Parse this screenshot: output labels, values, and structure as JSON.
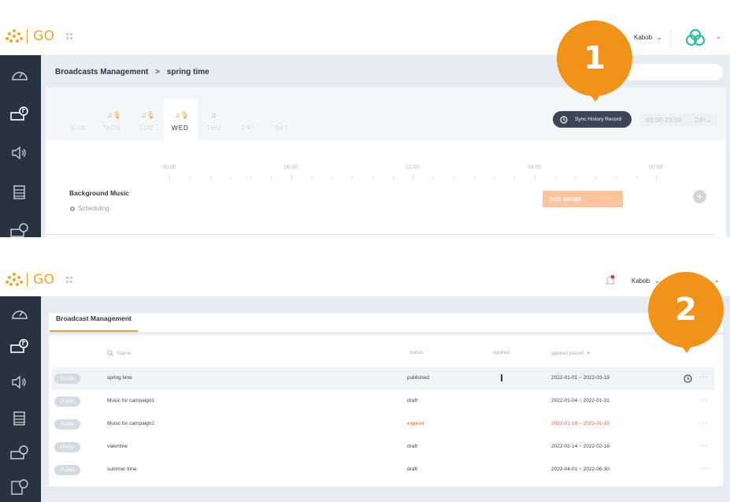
{
  "app": {
    "brand": "GO",
    "user_name": "Kabob"
  },
  "panel1": {
    "breadcrumb": {
      "parent": "Broadcasts Management",
      "separator": ">",
      "current": "spring time"
    },
    "week_days": [
      {
        "label": "SUN",
        "active": false,
        "notes": ""
      },
      {
        "label": "MON",
        "active": false,
        "notes": "♫🎙"
      },
      {
        "label": "TUE",
        "active": false,
        "notes": "♫🎙"
      },
      {
        "label": "WED",
        "active": true,
        "notes": "♫🎙"
      },
      {
        "label": "THU",
        "active": false,
        "notes": "♫"
      },
      {
        "label": "FRI",
        "active": false,
        "notes": ""
      },
      {
        "label": "SAT",
        "active": false,
        "notes": ""
      }
    ],
    "sync_button_label": "Sync History Record",
    "time_range": "00:00-23:59",
    "time_format": "24h",
    "timeline_ticks": [
      "00:00",
      "06:00",
      "12:00",
      "18:00",
      "00:00"
    ],
    "schedule": {
      "label": "Background Music",
      "sub_label": "Scheduling",
      "block_label": "jazz songs",
      "block_color": "#ffc39e"
    },
    "callout_number": "1"
  },
  "panel2": {
    "tab_label": "Broadcast Management",
    "columns": {
      "name": "Name",
      "status": "status",
      "applied": "applied",
      "applied_period": "applied period"
    },
    "rows": [
      {
        "badge": "Public",
        "name": "spring time",
        "status": "published",
        "applied": "",
        "period": "2022-01-01 ~ 2022-03-19",
        "expired": false,
        "highlight": true,
        "clock": true
      },
      {
        "badge": "Public",
        "name": "Music for campaign1",
        "status": "draft",
        "applied": "",
        "period": "2022-01-04 ~ 2022-01-31",
        "expired": false,
        "highlight": false,
        "clock": false
      },
      {
        "badge": "Public",
        "name": "Music for campaign2",
        "status": "expired",
        "applied": "",
        "period": "2022-01-19 ~ 2022-01-19",
        "expired": true,
        "highlight": false,
        "clock": false
      },
      {
        "badge": "Public",
        "name": "valentine",
        "status": "draft",
        "applied": "",
        "period": "2022-02-14 ~ 2022-02-16",
        "expired": false,
        "highlight": false,
        "clock": false
      },
      {
        "badge": "Public",
        "name": "summer time",
        "status": "draft",
        "applied": "",
        "period": "2022-04-01 ~ 2022-06-30",
        "expired": false,
        "highlight": false,
        "clock": false
      }
    ],
    "more_label": "···",
    "callout_number": "2"
  },
  "colors": {
    "accent": "#f5a623",
    "callout": "#f29319",
    "sidebar": "#293240",
    "expired": "#e8603c",
    "brand_teal": "#2bbf9f"
  },
  "icons": {
    "sidebar": [
      "dashboard-gauge-icon",
      "broadcast-music-icon",
      "speaker-icon",
      "playlist-icon",
      "device-check-icon",
      "schedule-doc-icon"
    ],
    "other": [
      "apps-grid-icon",
      "brand-logo-icon",
      "bell-icon",
      "clock-icon",
      "gear-icon",
      "search-icon",
      "plus-icon"
    ]
  }
}
